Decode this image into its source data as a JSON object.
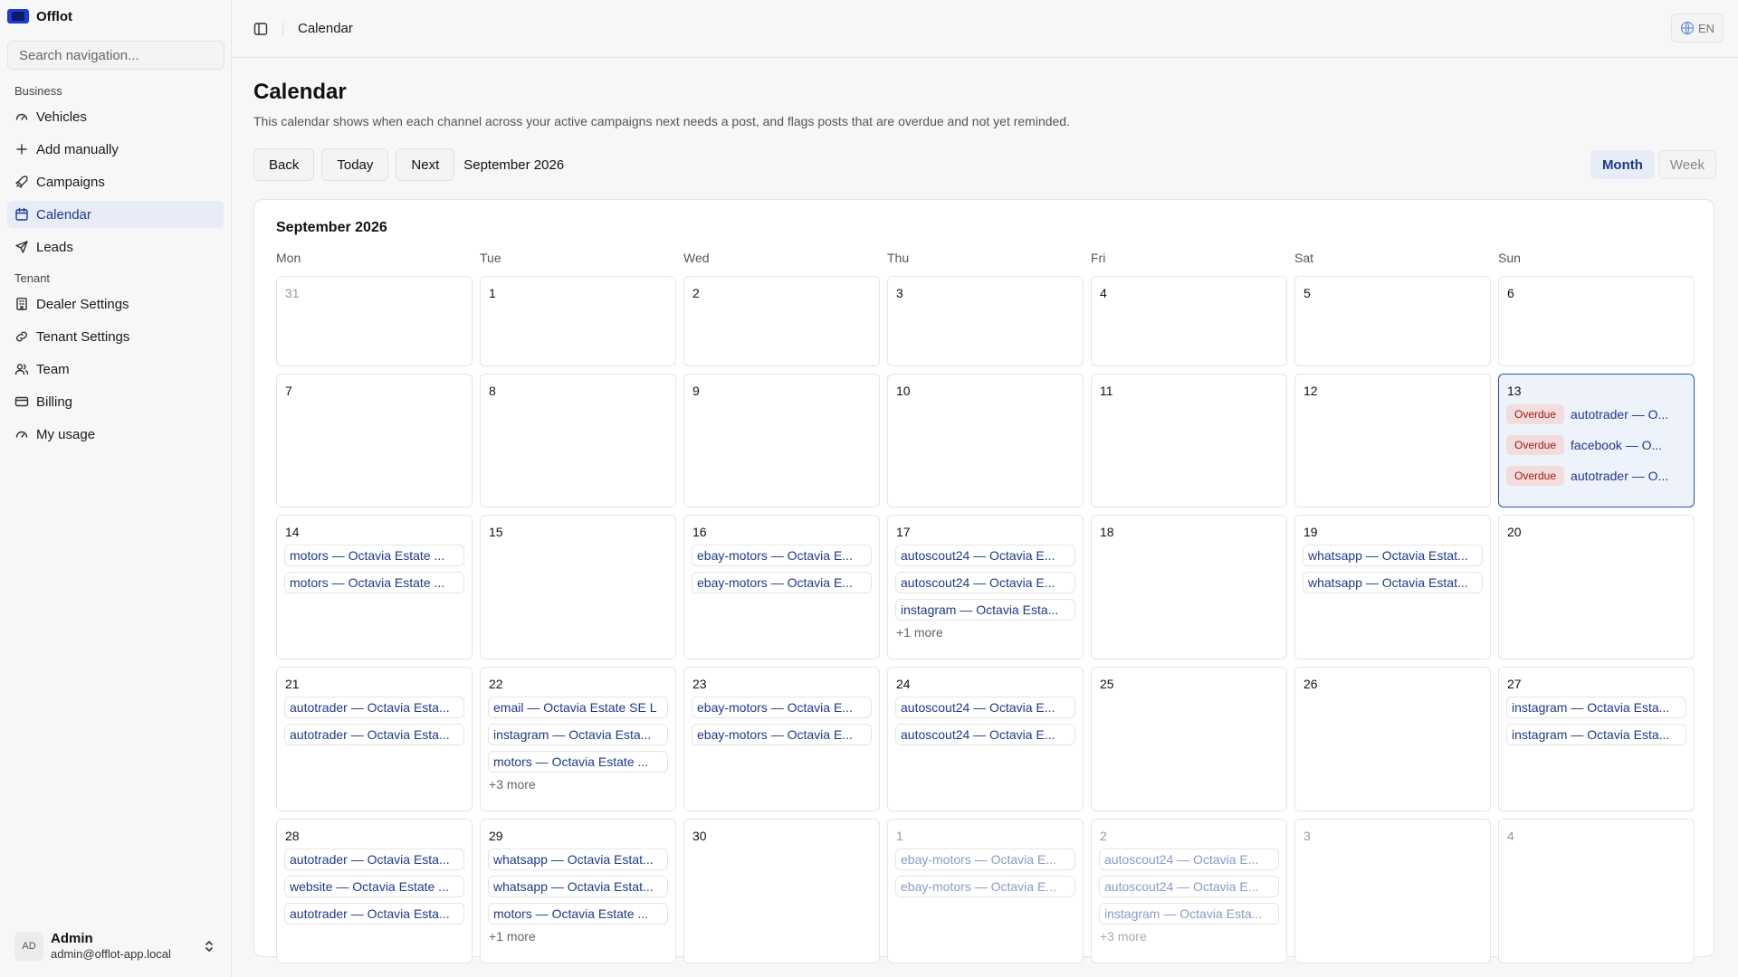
{
  "brand": {
    "name": "Offlot"
  },
  "sidebar": {
    "search_placeholder": "Search navigation...",
    "business_title": "Business",
    "business_items": [
      {
        "label": "Vehicles",
        "icon": "gauge-icon"
      },
      {
        "label": "Add manually",
        "icon": "plus-icon"
      },
      {
        "label": "Campaigns",
        "icon": "rocket-icon"
      },
      {
        "label": "Calendar",
        "icon": "calendar-icon",
        "active": true
      },
      {
        "label": "Leads",
        "icon": "send-icon"
      }
    ],
    "tenant_title": "Tenant",
    "tenant_items": [
      {
        "label": "Dealer Settings",
        "icon": "building-icon"
      },
      {
        "label": "Tenant Settings",
        "icon": "link-icon"
      },
      {
        "label": "Team",
        "icon": "users-icon"
      },
      {
        "label": "Billing",
        "icon": "card-icon"
      },
      {
        "label": "My usage",
        "icon": "gauge-icon"
      }
    ],
    "user": {
      "initials": "AD",
      "name": "Admin",
      "email": "admin@offlot-app.local"
    }
  },
  "header": {
    "breadcrumb": "Calendar",
    "language": "EN"
  },
  "page": {
    "title": "Calendar",
    "description": "This calendar shows when each channel across your active campaigns next needs a post, and flags posts that are overdue and not yet reminded.",
    "back_label": "Back",
    "today_label": "Today",
    "next_label": "Next",
    "period": "September 2026",
    "view_month": "Month",
    "view_week": "Week"
  },
  "calendar": {
    "title": "September 2026",
    "weekdays": [
      "Mon",
      "Tue",
      "Wed",
      "Thu",
      "Fri",
      "Sat",
      "Sun"
    ],
    "overdue_label": "Overdue",
    "weeks": [
      [
        {
          "num": "31",
          "muted": true,
          "events": []
        },
        {
          "num": "1",
          "events": []
        },
        {
          "num": "2",
          "events": []
        },
        {
          "num": "3",
          "events": []
        },
        {
          "num": "4",
          "events": []
        },
        {
          "num": "5",
          "events": []
        },
        {
          "num": "6",
          "events": []
        }
      ],
      [
        {
          "num": "7",
          "events": []
        },
        {
          "num": "8",
          "events": []
        },
        {
          "num": "9",
          "events": []
        },
        {
          "num": "10",
          "events": []
        },
        {
          "num": "11",
          "events": []
        },
        {
          "num": "12",
          "events": []
        },
        {
          "num": "13",
          "today": true,
          "events": [
            {
              "text": "autotrader — O...",
              "overdue": true
            },
            {
              "text": "facebook — O...",
              "overdue": true
            },
            {
              "text": "autotrader — O...",
              "overdue": true
            }
          ]
        }
      ],
      [
        {
          "num": "14",
          "events": [
            {
              "text": "motors — Octavia Estate ..."
            },
            {
              "text": "motors — Octavia Estate ..."
            }
          ]
        },
        {
          "num": "15",
          "events": []
        },
        {
          "num": "16",
          "events": [
            {
              "text": "ebay-motors — Octavia E..."
            },
            {
              "text": "ebay-motors — Octavia E..."
            }
          ]
        },
        {
          "num": "17",
          "events": [
            {
              "text": "autoscout24 — Octavia E..."
            },
            {
              "text": "autoscout24 — Octavia E..."
            },
            {
              "text": "instagram — Octavia Esta..."
            }
          ],
          "more": "+1 more"
        },
        {
          "num": "18",
          "events": []
        },
        {
          "num": "19",
          "events": [
            {
              "text": "whatsapp — Octavia Estat..."
            },
            {
              "text": "whatsapp — Octavia Estat..."
            }
          ]
        },
        {
          "num": "20",
          "events": []
        }
      ],
      [
        {
          "num": "21",
          "events": [
            {
              "text": "autotrader — Octavia Esta..."
            },
            {
              "text": "autotrader — Octavia Esta..."
            }
          ]
        },
        {
          "num": "22",
          "events": [
            {
              "text": "email — Octavia Estate SE L"
            },
            {
              "text": "instagram — Octavia Esta..."
            },
            {
              "text": "motors — Octavia Estate ..."
            }
          ],
          "more": "+3 more"
        },
        {
          "num": "23",
          "events": [
            {
              "text": "ebay-motors — Octavia E..."
            },
            {
              "text": "ebay-motors — Octavia E..."
            }
          ]
        },
        {
          "num": "24",
          "events": [
            {
              "text": "autoscout24 — Octavia E..."
            },
            {
              "text": "autoscout24 — Octavia E..."
            }
          ]
        },
        {
          "num": "25",
          "events": []
        },
        {
          "num": "26",
          "events": []
        },
        {
          "num": "27",
          "events": [
            {
              "text": "instagram — Octavia Esta..."
            },
            {
              "text": "instagram — Octavia Esta..."
            }
          ]
        }
      ],
      [
        {
          "num": "28",
          "events": [
            {
              "text": "autotrader — Octavia Esta..."
            },
            {
              "text": "website — Octavia Estate ..."
            },
            {
              "text": "autotrader — Octavia Esta..."
            }
          ]
        },
        {
          "num": "29",
          "events": [
            {
              "text": "whatsapp — Octavia Estat..."
            },
            {
              "text": "whatsapp — Octavia Estat..."
            },
            {
              "text": "motors — Octavia Estate ..."
            }
          ],
          "more": "+1 more"
        },
        {
          "num": "30",
          "events": []
        },
        {
          "num": "1",
          "muted": true,
          "events": [
            {
              "text": "ebay-motors — Octavia E..."
            },
            {
              "text": "ebay-motors — Octavia E..."
            }
          ]
        },
        {
          "num": "2",
          "muted": true,
          "events": [
            {
              "text": "autoscout24 — Octavia E..."
            },
            {
              "text": "autoscout24 — Octavia E..."
            },
            {
              "text": "instagram — Octavia Esta..."
            }
          ],
          "more": "+3 more"
        },
        {
          "num": "3",
          "muted": true,
          "events": []
        },
        {
          "num": "4",
          "muted": true,
          "events": []
        }
      ]
    ]
  }
}
